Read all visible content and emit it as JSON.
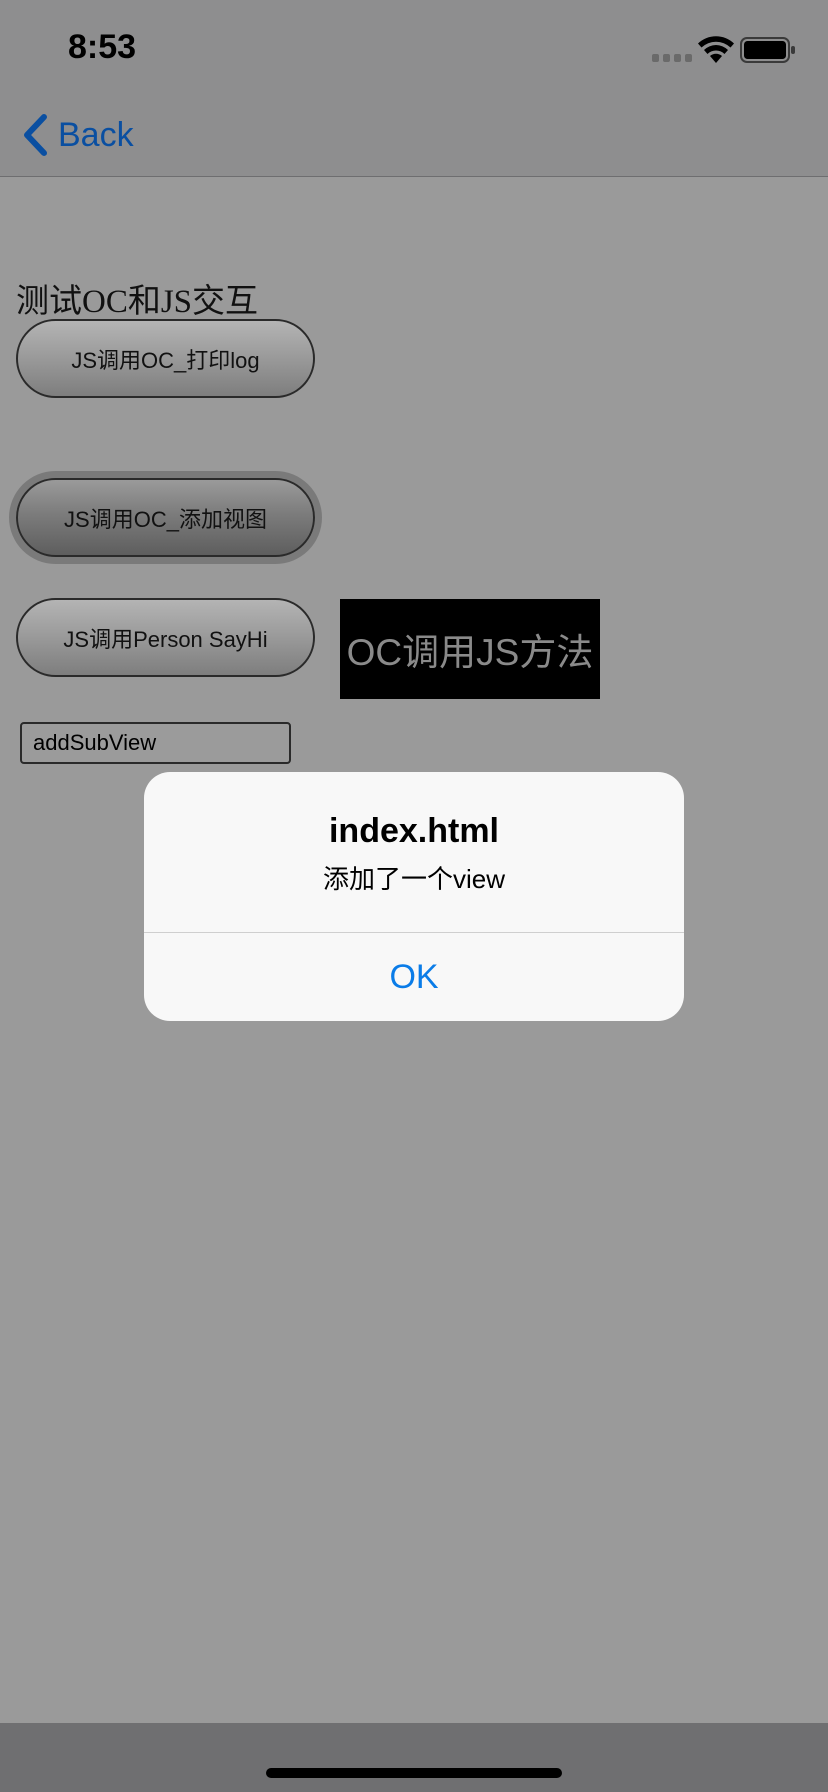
{
  "status_bar": {
    "time": "8:53"
  },
  "nav": {
    "back_label": "Back",
    "accent_color": "#0a4fa1"
  },
  "page": {
    "heading": "测试OC和JS交互",
    "buttons": {
      "log": "JS调用OC_打印log",
      "add_view": "JS调用OC_添加视图",
      "say_hi": "JS调用Person SayHi",
      "call_js": "OC调用JS方法"
    },
    "text_field_value": "addSubView"
  },
  "alert": {
    "title": "index.html",
    "message": "添加了一个view",
    "ok_label": "OK",
    "ok_color": "#0a7ce8"
  },
  "icons": [
    "chevron-left-icon",
    "signal-icon",
    "wifi-icon",
    "battery-icon"
  ]
}
